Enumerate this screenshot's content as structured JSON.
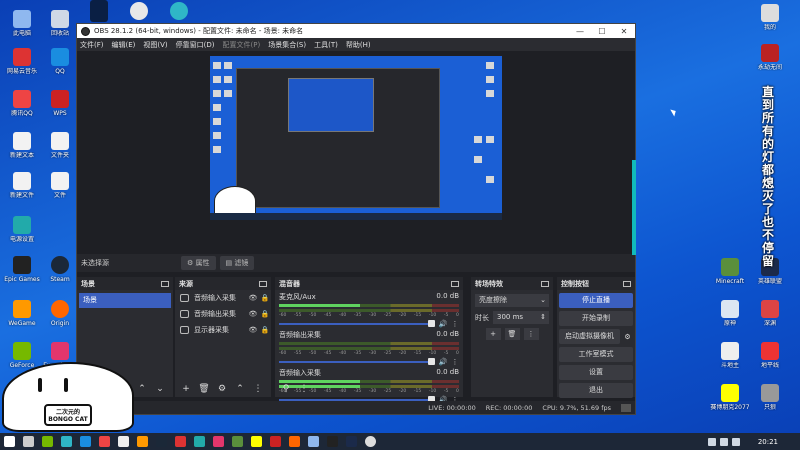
{
  "window": {
    "title": "OBS 28.1.2 (64-bit, windows) - 配置文件: 未命名 - 场景: 未命名",
    "controls": {
      "minimize": "—",
      "maximize": "☐",
      "close": "✕"
    }
  },
  "menu": [
    "文件(F)",
    "编辑(E)",
    "视图(V)",
    "停靠窗口(D)",
    "配置文件(P)",
    "场景集合(S)",
    "工具(T)",
    "帮助(H)"
  ],
  "context_bar": {
    "no_source": "未选择源",
    "properties": "属性",
    "filters": "滤镜"
  },
  "scenes": {
    "title": "场景",
    "items": [
      "场景"
    ]
  },
  "sources": {
    "title": "来源",
    "items": [
      {
        "name": "音频输入采集",
        "icon": "mic-icon"
      },
      {
        "name": "音频输出采集",
        "icon": "speaker-icon"
      },
      {
        "name": "显示器采集",
        "icon": "monitor-icon"
      }
    ]
  },
  "mixer": {
    "title": "混音器",
    "scale": [
      "-60",
      "-55",
      "-50",
      "-45",
      "-40",
      "-35",
      "-30",
      "-25",
      "-20",
      "-15",
      "-10",
      "-5",
      "0"
    ],
    "channels": [
      {
        "name": "麦克风/Aux",
        "db": "0.0 dB"
      },
      {
        "name": "音频输出采集",
        "db": "0.0 dB"
      },
      {
        "name": "音频输入采集",
        "db": "0.0 dB"
      }
    ]
  },
  "transitions": {
    "title": "转场特效",
    "type": "亮度擦除",
    "duration_label": "时长",
    "duration": "300 ms"
  },
  "controls": {
    "title": "控制按钮",
    "stop_stream": "停止直播",
    "start_record": "开始录制",
    "virtual_cam": "启动虚拟摄像机",
    "studio_mode": "工作室模式",
    "settings": "设置",
    "exit": "退出"
  },
  "status": {
    "live": "LIVE: 00:00:00",
    "rec": "REC: 00:00:00",
    "cpu": "CPU: 9.7%, 51.69 fps"
  },
  "desktop": {
    "left_icons": [
      "此电脑",
      "回收站",
      "网易云音乐",
      "QQ",
      "腾讯QQ",
      "WPS",
      "新建文本",
      "文件夹",
      "新建文件",
      "文件",
      "电源设置",
      "浏览器",
      "Epic Games",
      "Steam",
      "WeGame",
      "Origin",
      "GeForce",
      "Experience"
    ],
    "right_icons": [
      "我的",
      "永劫无间",
      "Minecraft",
      "英雄联盟",
      "原神",
      "深渊",
      "斗地主",
      "地平线",
      "赛博朋克2077",
      "只狼"
    ],
    "overlay_text": "直到所有的灯都熄灭了也不停留",
    "clock": "20:21",
    "watermark": "二次元的BONGO CAT"
  }
}
